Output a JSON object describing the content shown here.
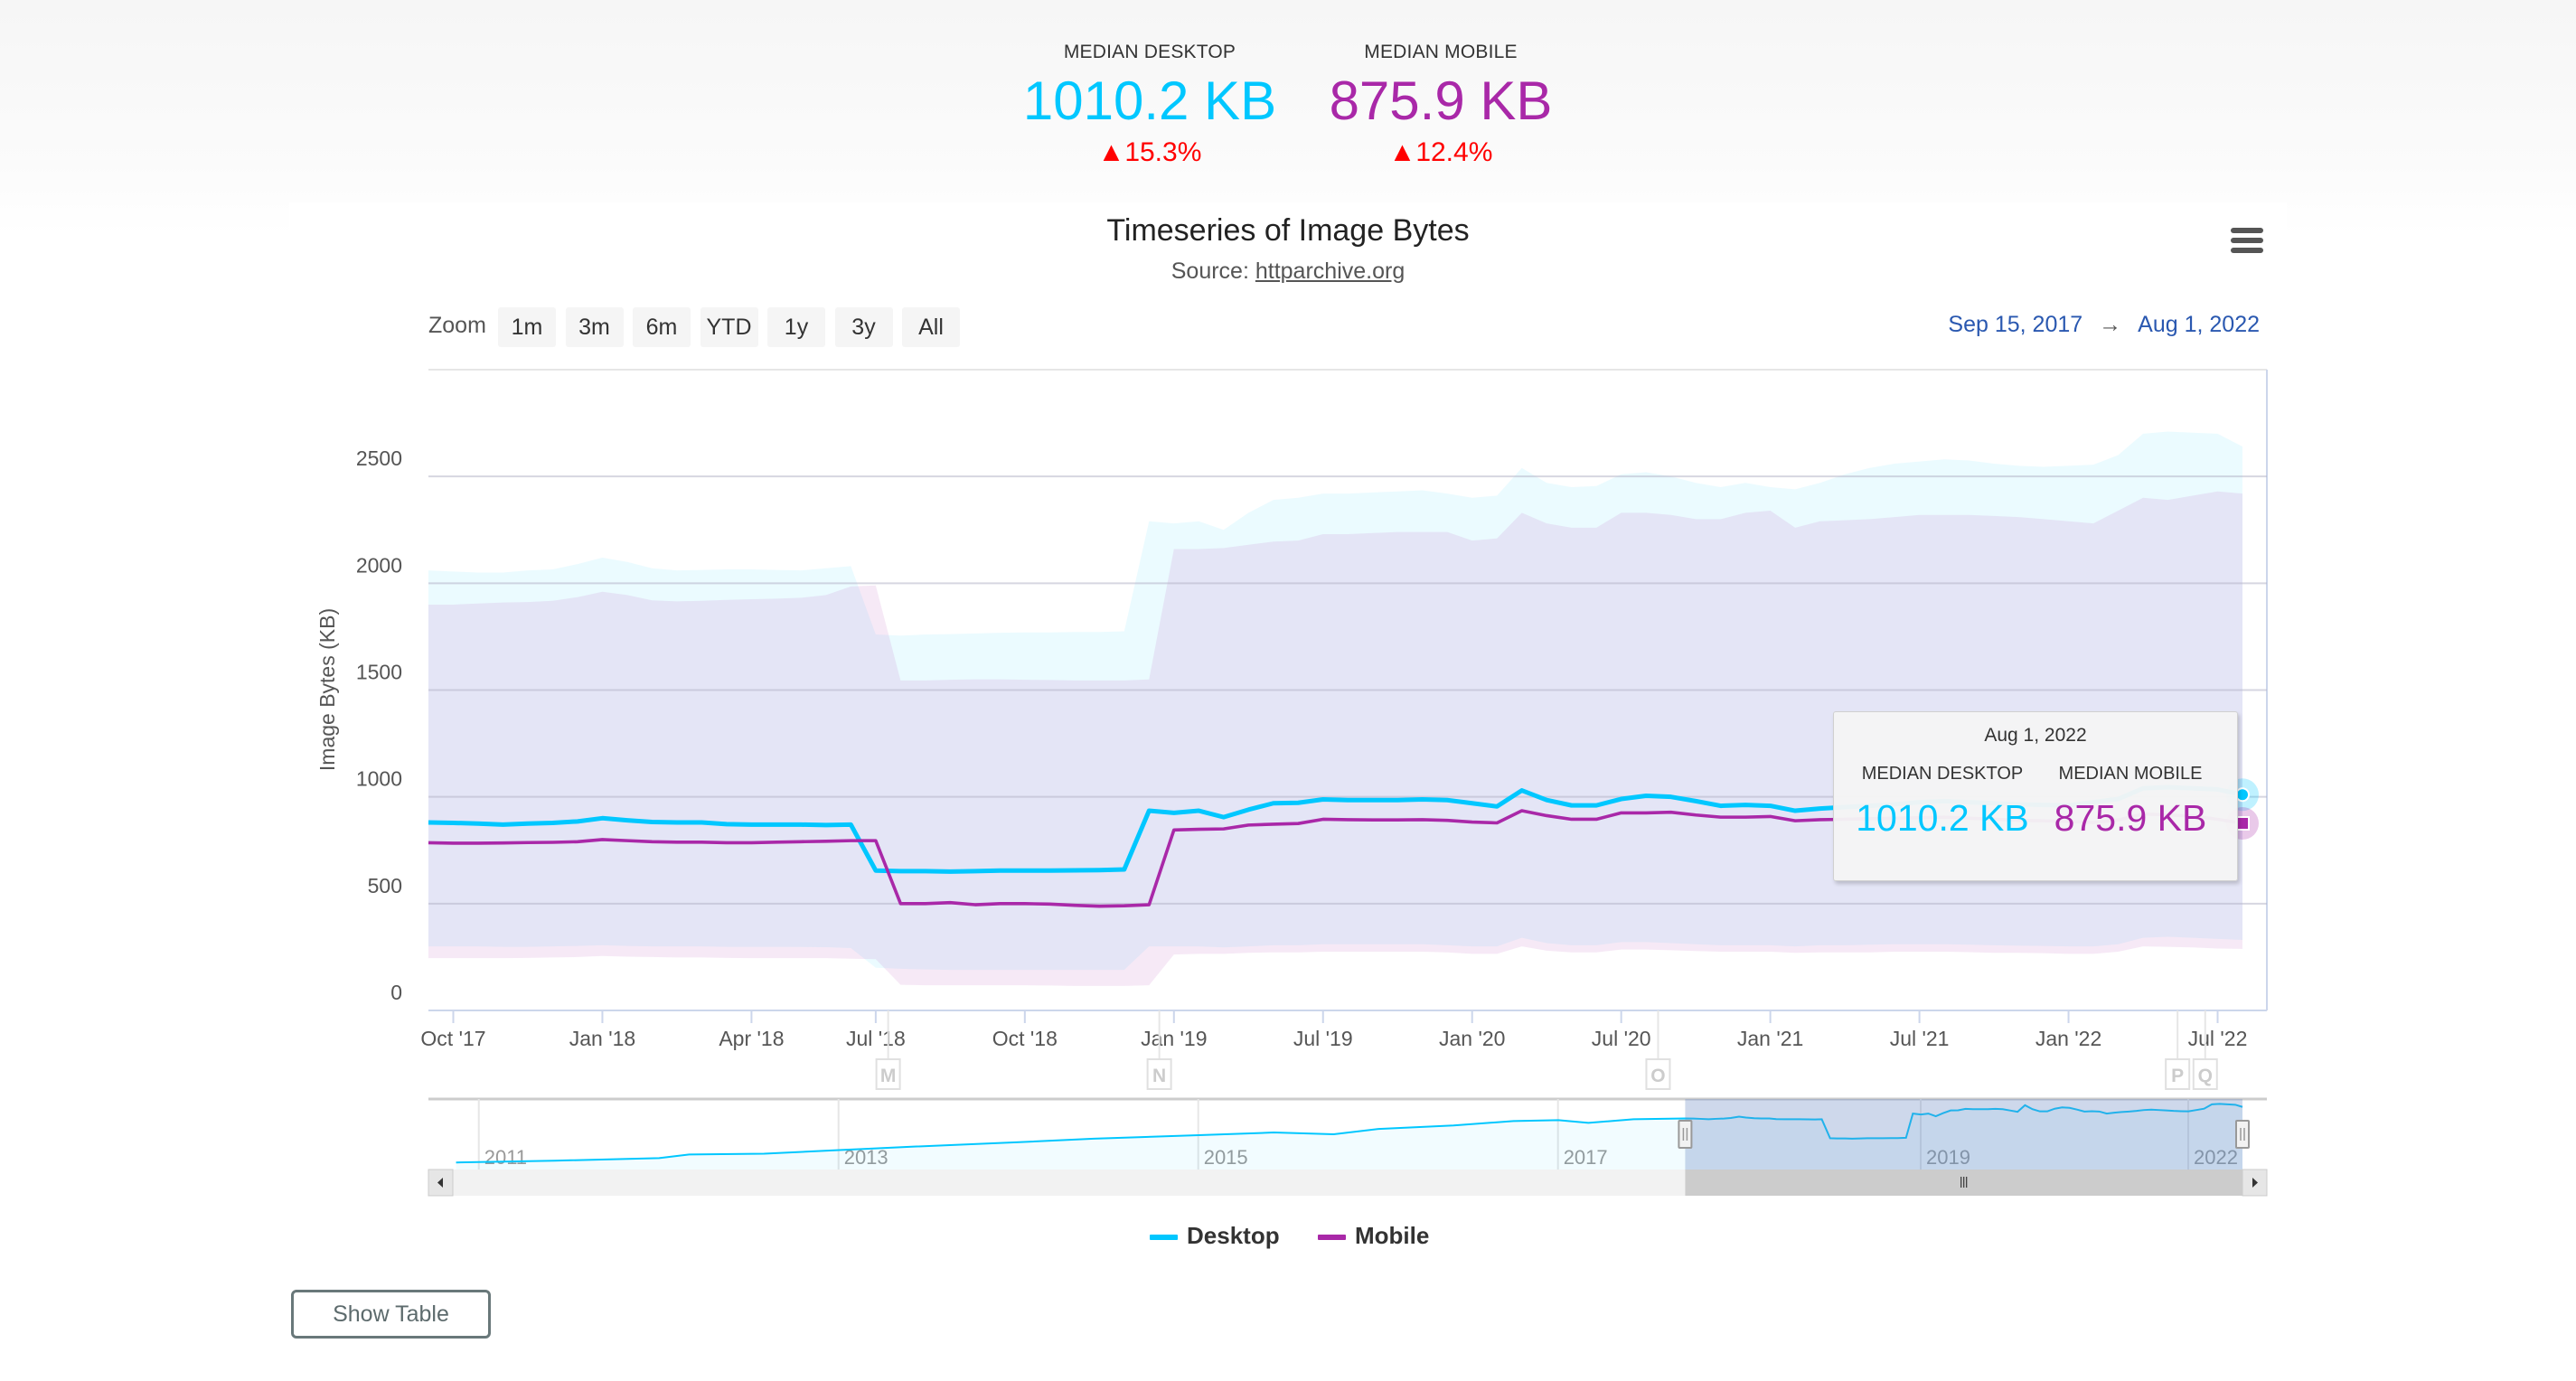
{
  "summary": {
    "desktop": {
      "label": "MEDIAN DESKTOP",
      "value": "1010.2 KB",
      "delta": "15.3%",
      "delta_icon": "triangle-up-icon"
    },
    "mobile": {
      "label": "MEDIAN MOBILE",
      "value": "875.9 KB",
      "delta": "12.4%",
      "delta_icon": "triangle-up-icon"
    }
  },
  "colors": {
    "desktop": "#00c7ff",
    "mobile": "#a928a8",
    "delta_up": "#ff0000",
    "range_text": "#2a58b0"
  },
  "chart_header": {
    "title": "Timeseries of Image Bytes",
    "source_prefix": "Source: ",
    "source_link": "httparchive.org",
    "menu_icon": "hamburger-menu-icon"
  },
  "range_selector": {
    "zoom_label": "Zoom",
    "buttons": [
      "1m",
      "3m",
      "6m",
      "YTD",
      "1y",
      "3y",
      "All"
    ],
    "from": "Sep 15, 2017",
    "arrow": "→",
    "to": "Aug 1, 2022"
  },
  "tooltip": {
    "date": "Aug 1, 2022",
    "desktop_label": "MEDIAN DESKTOP",
    "desktop_value": "1010.2 KB",
    "mobile_label": "MEDIAN MOBILE",
    "mobile_value": "875.9 KB"
  },
  "legend": [
    {
      "name": "Desktop"
    },
    {
      "name": "Mobile"
    }
  ],
  "show_table_label": "Show Table",
  "chart_data": {
    "type": "line",
    "title": "Timeseries of Image Bytes",
    "subtitle": "Source: httparchive.org",
    "ylabel": "Image Bytes (KB)",
    "ylim": [
      0,
      3000
    ],
    "yticks": [
      0,
      500,
      1000,
      1500,
      2000,
      2500
    ],
    "xaxis": "ordinal dates",
    "xlim": [
      "2017-09-15",
      "2022-08-01"
    ],
    "xticks": [
      {
        "date": "2017-10-01",
        "label": "Oct '17"
      },
      {
        "date": "2018-01-01",
        "label": "Jan '18"
      },
      {
        "date": "2018-04-01",
        "label": "Apr '18"
      },
      {
        "date": "2018-07-01",
        "label": "Jul '18"
      },
      {
        "date": "2018-10-01",
        "label": "Oct '18"
      },
      {
        "date": "2019-01-01",
        "label": "Jan '19"
      },
      {
        "date": "2019-07-01",
        "label": "Jul '19"
      },
      {
        "date": "2020-01-01",
        "label": "Jan '20"
      },
      {
        "date": "2020-07-01",
        "label": "Jul '20"
      },
      {
        "date": "2021-01-01",
        "label": "Jan '21"
      },
      {
        "date": "2021-07-01",
        "label": "Jul '21"
      },
      {
        "date": "2022-01-01",
        "label": "Jan '22"
      },
      {
        "date": "2022-07-01",
        "label": "Jul '22"
      }
    ],
    "grid": true,
    "legend_position": "bottom",
    "columns": [
      "date",
      "desktop_median",
      "mobile_median",
      "desktop_low",
      "desktop_high",
      "mobile_low",
      "mobile_high"
    ],
    "rows": [
      [
        "2017-09-15",
        880,
        785,
        300,
        2060,
        245,
        1900
      ],
      [
        "2017-10-01",
        878,
        783,
        300,
        2055,
        245,
        1900
      ],
      [
        "2017-10-15",
        875,
        783,
        300,
        2050,
        245,
        1905
      ],
      [
        "2017-11-01",
        870,
        784,
        298,
        2050,
        245,
        1910
      ],
      [
        "2017-11-15",
        875,
        786,
        298,
        2060,
        246,
        1912
      ],
      [
        "2017-12-01",
        878,
        787,
        300,
        2065,
        248,
        1918
      ],
      [
        "2017-12-15",
        885,
        790,
        302,
        2090,
        250,
        1935
      ],
      [
        "2018-01-01",
        900,
        800,
        305,
        2120,
        255,
        1960
      ],
      [
        "2018-01-15",
        890,
        795,
        302,
        2100,
        252,
        1945
      ],
      [
        "2018-02-01",
        882,
        790,
        300,
        2070,
        250,
        1920
      ],
      [
        "2018-02-15",
        880,
        788,
        300,
        2060,
        248,
        1915
      ],
      [
        "2018-03-01",
        880,
        788,
        300,
        2062,
        248,
        1918
      ],
      [
        "2018-03-15",
        872,
        785,
        298,
        2065,
        246,
        1922
      ],
      [
        "2018-04-01",
        870,
        785,
        298,
        2065,
        245,
        1925
      ],
      [
        "2018-04-15",
        870,
        788,
        298,
        2062,
        245,
        1928
      ],
      [
        "2018-05-01",
        870,
        790,
        297,
        2060,
        245,
        1932
      ],
      [
        "2018-06-01",
        868,
        792,
        296,
        2070,
        245,
        1945
      ],
      [
        "2018-06-15",
        870,
        795,
        292,
        2080,
        242,
        1985
      ],
      [
        "2018-07-01",
        655,
        795,
        200,
        1760,
        240,
        1990
      ],
      [
        "2018-07-15",
        652,
        500,
        195,
        1755,
        120,
        1545
      ],
      [
        "2018-08-01",
        652,
        500,
        192,
        1760,
        118,
        1545
      ],
      [
        "2018-08-15",
        650,
        505,
        190,
        1762,
        118,
        1548
      ],
      [
        "2018-09-01",
        652,
        495,
        190,
        1765,
        118,
        1550
      ],
      [
        "2018-09-15",
        655,
        500,
        190,
        1768,
        118,
        1550
      ],
      [
        "2018-10-01",
        655,
        500,
        190,
        1770,
        118,
        1548
      ],
      [
        "2018-10-15",
        655,
        498,
        190,
        1770,
        117,
        1547
      ],
      [
        "2018-11-01",
        656,
        492,
        190,
        1772,
        115,
        1545
      ],
      [
        "2018-11-15",
        657,
        488,
        190,
        1772,
        115,
        1545
      ],
      [
        "2018-12-01",
        660,
        490,
        190,
        1775,
        115,
        1545
      ],
      [
        "2018-12-15",
        935,
        495,
        300,
        2290,
        118,
        1550
      ],
      [
        "2019-01-01",
        925,
        845,
        300,
        2280,
        262,
        2160
      ],
      [
        "2019-02-01",
        935,
        848,
        300,
        2290,
        265,
        2160
      ],
      [
        "2019-03-01",
        905,
        850,
        295,
        2250,
        265,
        2165
      ],
      [
        "2019-04-01",
        940,
        868,
        300,
        2330,
        270,
        2180
      ],
      [
        "2019-05-01",
        970,
        872,
        305,
        2390,
        272,
        2195
      ],
      [
        "2019-06-01",
        972,
        875,
        305,
        2400,
        272,
        2200
      ],
      [
        "2019-07-01",
        988,
        895,
        310,
        2420,
        275,
        2230
      ],
      [
        "2019-08-01",
        985,
        893,
        310,
        2420,
        275,
        2230
      ],
      [
        "2019-09-01",
        985,
        892,
        310,
        2425,
        275,
        2235
      ],
      [
        "2019-10-01",
        985,
        892,
        310,
        2430,
        275,
        2240
      ],
      [
        "2019-11-01",
        988,
        893,
        310,
        2435,
        275,
        2240
      ],
      [
        "2019-12-01",
        985,
        890,
        305,
        2420,
        272,
        2240
      ],
      [
        "2020-01-01",
        970,
        882,
        300,
        2400,
        265,
        2200
      ],
      [
        "2020-02-01",
        955,
        878,
        300,
        2410,
        265,
        2210
      ],
      [
        "2020-03-01",
        1030,
        935,
        340,
        2540,
        300,
        2330
      ],
      [
        "2020-04-01",
        985,
        912,
        315,
        2470,
        280,
        2280
      ],
      [
        "2020-05-01",
        960,
        895,
        305,
        2450,
        272,
        2260
      ],
      [
        "2020-06-01",
        960,
        895,
        305,
        2455,
        272,
        2260
      ],
      [
        "2020-07-01",
        990,
        925,
        320,
        2510,
        285,
        2330
      ],
      [
        "2020-08-01",
        1005,
        925,
        320,
        2520,
        285,
        2330
      ],
      [
        "2020-09-01",
        1000,
        928,
        315,
        2500,
        282,
        2320
      ],
      [
        "2020-10-01",
        980,
        915,
        310,
        2470,
        278,
        2300
      ],
      [
        "2020-11-01",
        958,
        905,
        305,
        2450,
        275,
        2300
      ],
      [
        "2020-12-01",
        962,
        905,
        305,
        2470,
        275,
        2330
      ],
      [
        "2021-01-01",
        958,
        908,
        305,
        2450,
        275,
        2340
      ],
      [
        "2021-02-01",
        935,
        888,
        300,
        2440,
        270,
        2260
      ],
      [
        "2021-03-01",
        945,
        893,
        305,
        2470,
        272,
        2290
      ],
      [
        "2021-04-01",
        952,
        895,
        305,
        2510,
        272,
        2295
      ],
      [
        "2021-05-01",
        958,
        898,
        308,
        2540,
        272,
        2300
      ],
      [
        "2021-06-01",
        965,
        900,
        310,
        2560,
        275,
        2310
      ],
      [
        "2021-07-01",
        975,
        902,
        310,
        2570,
        275,
        2320
      ],
      [
        "2021-08-01",
        980,
        905,
        310,
        2580,
        275,
        2320
      ],
      [
        "2021-09-01",
        975,
        900,
        308,
        2575,
        273,
        2320
      ],
      [
        "2021-10-01",
        970,
        895,
        305,
        2560,
        270,
        2315
      ],
      [
        "2021-11-01",
        965,
        890,
        303,
        2550,
        270,
        2310
      ],
      [
        "2021-12-01",
        962,
        888,
        302,
        2545,
        268,
        2300
      ],
      [
        "2022-01-01",
        960,
        885,
        300,
        2550,
        265,
        2290
      ],
      [
        "2022-02-01",
        975,
        880,
        300,
        2555,
        265,
        2280
      ],
      [
        "2022-03-01",
        990,
        892,
        310,
        2600,
        275,
        2340
      ],
      [
        "2022-04-01",
        1040,
        920,
        340,
        2700,
        300,
        2400
      ],
      [
        "2022-05-01",
        1045,
        915,
        345,
        2710,
        298,
        2390
      ],
      [
        "2022-06-01",
        1040,
        910,
        340,
        2705,
        295,
        2410
      ],
      [
        "2022-07-01",
        1035,
        895,
        335,
        2700,
        290,
        2430
      ],
      [
        "2022-08-01",
        1010.2,
        875.9,
        330,
        2640,
        288,
        2420
      ]
    ],
    "series": [
      {
        "name": "Desktop",
        "column": "desktop_median"
      },
      {
        "name": "Mobile",
        "column": "mobile_median"
      }
    ],
    "flags": [
      {
        "title": "M",
        "date": "2018-07-08"
      },
      {
        "title": "N",
        "date": "2018-12-22"
      },
      {
        "title": "O",
        "date": "2020-08-16"
      },
      {
        "title": "P",
        "date": "2022-05-13"
      },
      {
        "title": "Q",
        "date": "2022-06-16"
      }
    ],
    "navigator": {
      "year_labels": [
        "2011",
        "2013",
        "2015",
        "2017",
        "2019",
        "2022"
      ],
      "selected_range": [
        "2017-09-15",
        "2022-08-01"
      ],
      "history": [
        [
          "2010-11-15",
          380
        ],
        [
          "2011-06-01",
          400
        ],
        [
          "2012-01-01",
          430
        ],
        [
          "2012-03-01",
          470
        ],
        [
          "2012-08-01",
          480
        ],
        [
          "2013-01-01",
          520
        ],
        [
          "2013-06-01",
          560
        ],
        [
          "2014-01-01",
          610
        ],
        [
          "2014-06-01",
          650
        ],
        [
          "2015-01-01",
          690
        ],
        [
          "2015-06-01",
          720
        ],
        [
          "2015-10-01",
          700
        ],
        [
          "2016-01-01",
          760
        ],
        [
          "2016-06-01",
          800
        ],
        [
          "2016-10-01",
          850
        ],
        [
          "2017-01-01",
          860
        ],
        [
          "2017-03-01",
          830
        ],
        [
          "2017-06-01",
          870
        ]
      ]
    }
  }
}
